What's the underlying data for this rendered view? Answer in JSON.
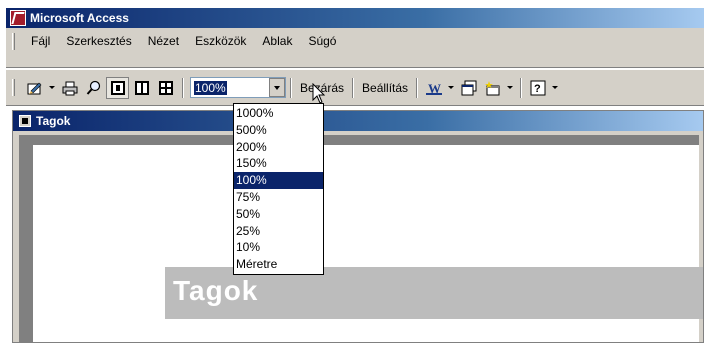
{
  "app": {
    "title": "Microsoft Access"
  },
  "menubar": {
    "items": [
      {
        "label": "Fájl"
      },
      {
        "label": "Szerkesztés"
      },
      {
        "label": "Nézet"
      },
      {
        "label": "Eszközök"
      },
      {
        "label": "Ablak"
      },
      {
        "label": "Súgó"
      }
    ]
  },
  "toolbar": {
    "zoom_value": "100%",
    "close_label": "Bezárás",
    "settings_label": "Beállítás",
    "icons": {
      "view": "design-view-icon",
      "print": "printer-icon",
      "zoom": "magnifier-icon",
      "one_page": "one-page-icon",
      "two_pages": "two-pages-icon",
      "multiple_pages": "multiple-pages-icon",
      "office_links": "word-icon",
      "database_window": "database-window-icon",
      "new_object": "new-object-icon",
      "help": "help-icon"
    }
  },
  "zoom_options": [
    {
      "label": "1000%"
    },
    {
      "label": "500%"
    },
    {
      "label": "200%"
    },
    {
      "label": "150%"
    },
    {
      "label": "100%",
      "selected": true
    },
    {
      "label": "75%"
    },
    {
      "label": "50%"
    },
    {
      "label": "25%"
    },
    {
      "label": "10%"
    },
    {
      "label": "Méretre"
    }
  ],
  "document": {
    "window_title": "Tagok",
    "report_title": "Tagok"
  },
  "colors": {
    "titlebar_start": "#0a246a",
    "titlebar_end": "#a6caf0",
    "selection": "#0a246a",
    "chrome": "#d4d0c8"
  }
}
